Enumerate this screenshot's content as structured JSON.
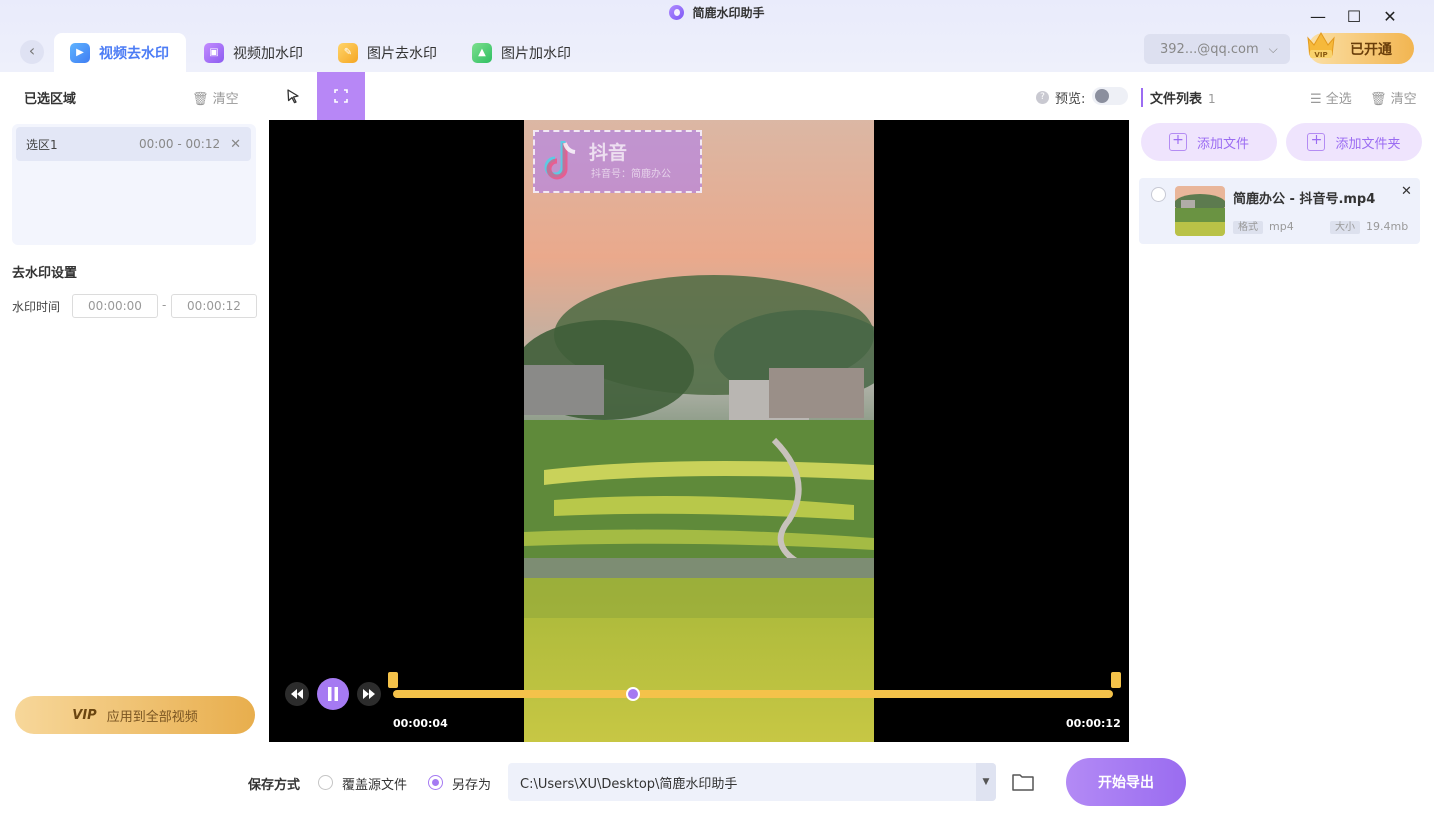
{
  "window": {
    "title": "简鹿水印助手",
    "controls": {
      "minimize": "—",
      "maximize": "☐",
      "close": "✕"
    }
  },
  "tabs": [
    {
      "label": "视频去水印",
      "icon": "video-remove-icon",
      "active": true
    },
    {
      "label": "视频加水印",
      "icon": "video-add-icon",
      "active": false
    },
    {
      "label": "图片去水印",
      "icon": "image-remove-icon",
      "active": false
    },
    {
      "label": "图片加水印",
      "icon": "image-add-icon",
      "active": false
    }
  ],
  "account": {
    "email": "392...@qq.com",
    "vip_label": "已开通",
    "crown_text": "VIP"
  },
  "left_panel": {
    "selected_title": "已选区域",
    "clear_label": "清空",
    "regions": [
      {
        "name": "选区1",
        "time": "00:00 - 00:12"
      }
    ],
    "settings_title": "去水印设置",
    "time_label": "水印时间",
    "time_start": "00:00:00",
    "time_sep": "-",
    "time_end": "00:00:12",
    "apply_vip": "VIP",
    "apply_label": "应用到全部视频"
  },
  "toolbar": {
    "preview_label": "预览:",
    "preview_on": false
  },
  "video": {
    "watermark_title": "抖音",
    "watermark_sub": "抖音号：简鹿办公",
    "current_time": "00:00:04",
    "end_time": "00:00:12",
    "progress": 0.333
  },
  "right_panel": {
    "title": "文件列表",
    "count": "1",
    "select_all": "全选",
    "clear_label": "清空",
    "add_file": "添加文件",
    "add_folder": "添加文件夹",
    "files": [
      {
        "name": "简鹿办公 - 抖音号.mp4",
        "format_tag": "格式",
        "format": "mp4",
        "size_tag": "大小",
        "size": "19.4mb"
      }
    ]
  },
  "bottom": {
    "save_label": "保存方式",
    "option_overwrite": "覆盖源文件",
    "option_saveas": "另存为",
    "selected": "saveas",
    "path": "C:\\Users\\XU\\Desktop\\简鹿水印助手",
    "export_label": "开始导出"
  },
  "colors": {
    "accent": "#a57af2",
    "tab_active": "#4c7cf5",
    "track": "#f4c24a",
    "vip_gold": "#f2b551"
  }
}
